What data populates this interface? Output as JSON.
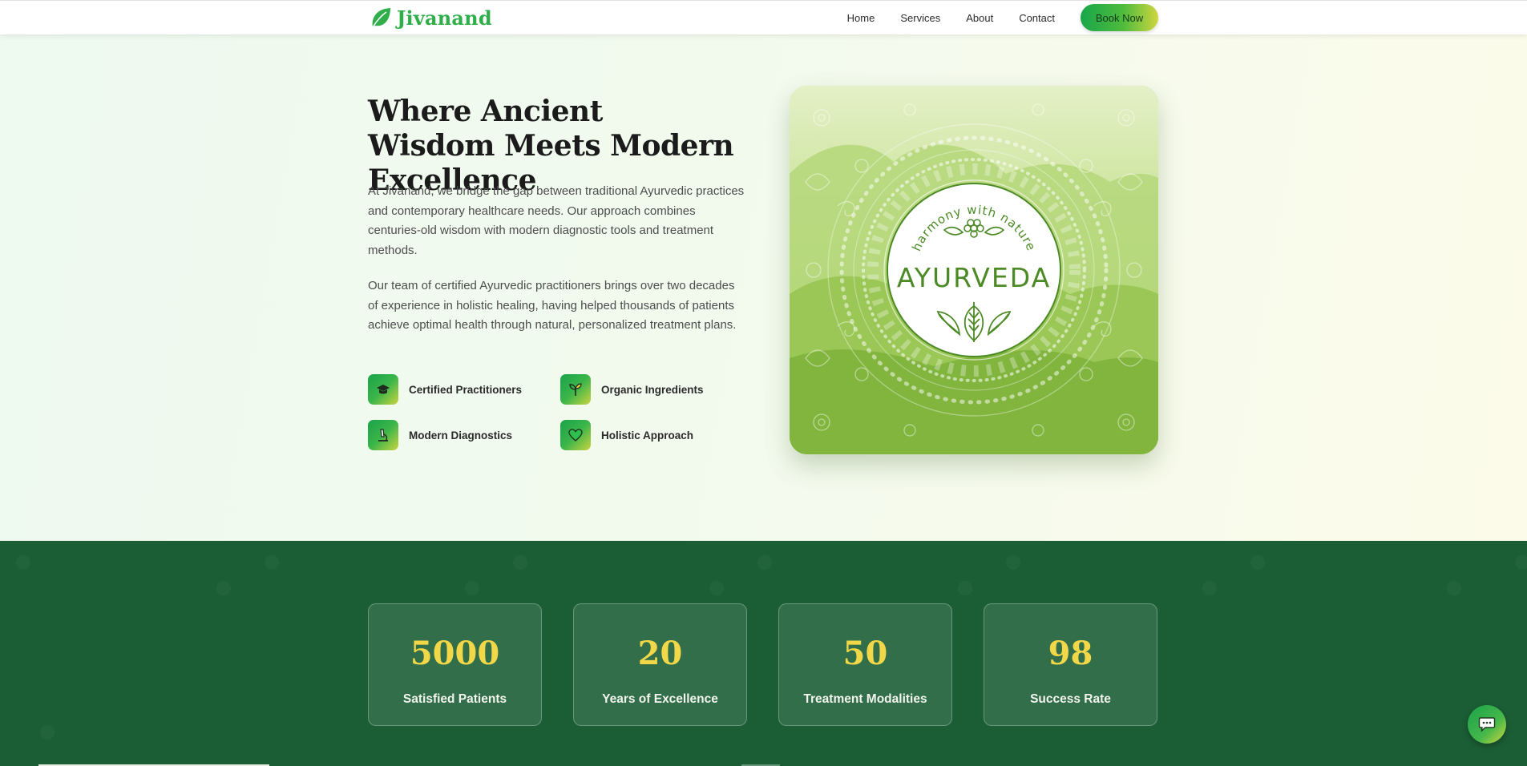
{
  "nav": {
    "logo_text": "Jivanand",
    "logo_icon": "leaf-icon",
    "links": [
      "Home",
      "Services",
      "About",
      "Contact"
    ],
    "cta": "Book Now"
  },
  "hero": {
    "title": "Where Ancient Wisdom Meets Modern Excellence",
    "paragraph1": "At Jivanand, we bridge the gap between traditional Ayurvedic practices and contemporary healthcare needs. Our approach combines centuries-old wisdom with modern diagnostic tools and treatment methods.",
    "paragraph2": "Our team of certified Ayurvedic practitioners brings over two decades of experience in holistic healing, having helped thousands of patients achieve optimal health through natural, personalized treatment plans.",
    "features": [
      {
        "label": "Certified Practitioners",
        "icon": "graduation-cap-icon"
      },
      {
        "label": "Organic Ingredients",
        "icon": "seedling-icon"
      },
      {
        "label": "Modern Diagnostics",
        "icon": "microscope-icon"
      },
      {
        "label": "Holistic Approach",
        "icon": "heart-icon"
      }
    ],
    "image": {
      "badge_top": "harmony with nature",
      "badge_word": "AYURVEDA"
    }
  },
  "stats": [
    {
      "value": "5000",
      "label": "Satisfied Patients"
    },
    {
      "value": "20",
      "label": "Years of Excellence"
    },
    {
      "value": "50",
      "label": "Treatment Modalities"
    },
    {
      "value": "98",
      "label": "Success Rate"
    }
  ],
  "chat": {
    "icon": "chat-icon"
  },
  "colors": {
    "brand_green": "#2fae4a",
    "dark_green": "#1b5e35",
    "accent_yellow": "#f2d848"
  }
}
